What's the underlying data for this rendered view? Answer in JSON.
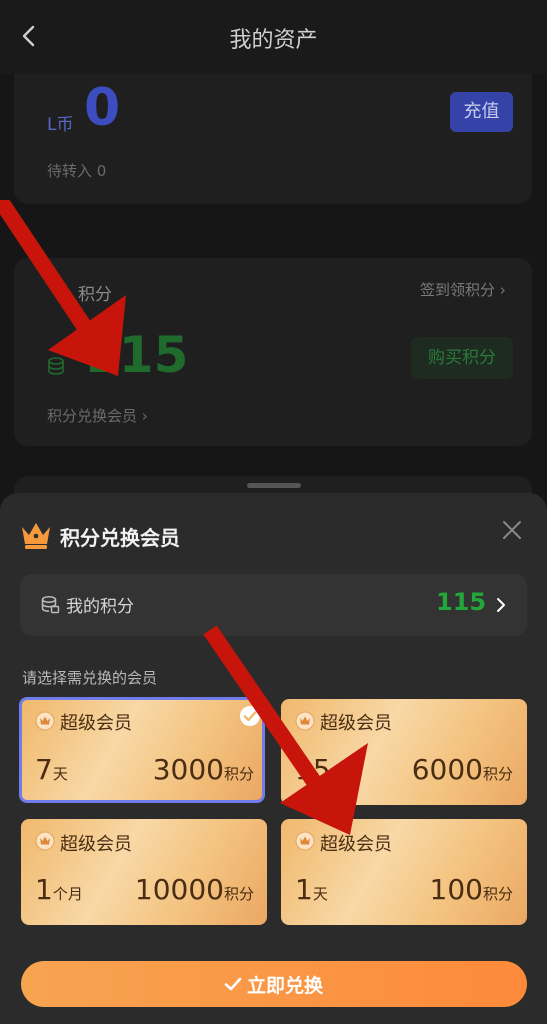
{
  "header": {
    "title": "我的资产"
  },
  "lcoin": {
    "unit": "L币",
    "value": "0",
    "recharge_label": "充值",
    "pending_text": "待转入 0"
  },
  "points_card": {
    "label": "积分",
    "checkin_link": "签到领积分 ›",
    "value": "115",
    "buy_label": "购买积分",
    "exchange_link": "积分兑换会员 ›"
  },
  "sheet": {
    "title": "积分兑换会员",
    "my_points_label": "我的积分",
    "my_points_value": "115",
    "choose_label": "请选择需兑换的会员",
    "options": [
      {
        "name": "超级会员",
        "duration_num": "7",
        "duration_unit": "天",
        "points_num": "3000",
        "points_unit": "积分",
        "selected": true
      },
      {
        "name": "超级会员",
        "duration_num": "15",
        "duration_unit": "天",
        "points_num": "6000",
        "points_unit": "积分",
        "selected": false
      },
      {
        "name": "超级会员",
        "duration_num": "1",
        "duration_unit": "个月",
        "points_num": "10000",
        "points_unit": "积分",
        "selected": false
      },
      {
        "name": "超级会员",
        "duration_num": "1",
        "duration_unit": "天",
        "points_num": "100",
        "points_unit": "积分",
        "selected": false
      }
    ],
    "submit_label": "立即兑换"
  },
  "colors": {
    "accent_orange": "#fd8a3a",
    "points_green": "#22a83a",
    "selected_border": "#6f7cea",
    "lcoin_blue": "#3d4cbe",
    "arrow_red": "#c8150c"
  }
}
